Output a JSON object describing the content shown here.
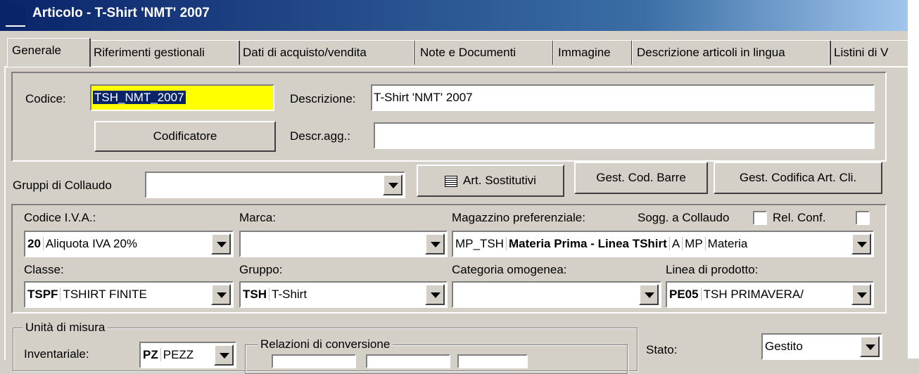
{
  "window": {
    "title": "Articolo - T-Shirt 'NMT' 2007"
  },
  "tabs": [
    "Generale",
    "Riferimenti gestionali",
    "Dati di acquisto/vendita",
    "Note e Documenti",
    "Immagine",
    "Descrizione articoli in lingua",
    "Listini di V"
  ],
  "header": {
    "codice_label": "Codice:",
    "codice_value": "TSH_NMT_2007",
    "descrizione_label": "Descrizione:",
    "descrizione_value": "T-Shirt 'NMT' 2007",
    "codificatore_label": "Codificatore",
    "descr_agg_label": "Descr.agg.:",
    "descr_agg_value": ""
  },
  "gruppi": {
    "label": "Gruppi di Collaudo",
    "value": "",
    "art_sostitutivi": "Art. Sostitutivi",
    "gest_cod_barre": "Gest. Cod. Barre",
    "gest_codifica": "Gest. Codifica Art. Cli."
  },
  "fields": {
    "iva_label": "Codice I.V.A.:",
    "iva_code": "20",
    "iva_desc": "Aliquota IVA 20%",
    "marca_label": "Marca:",
    "marca_value": "",
    "magazzino_label": "Magazzino preferenziale:",
    "magazzino_code": "MP_TSH",
    "magazzino_desc": "Materia Prima - Linea TShirt",
    "magazzino_extra1": "A",
    "magazzino_extra2": "MP",
    "magazzino_extra3": "Materia",
    "sogg_collaudo_label": "Sogg. a Collaudo",
    "rel_conf_label": "Rel. Conf.",
    "classe_label": "Classe:",
    "classe_code": "TSPF",
    "classe_desc": "TSHIRT FINITE",
    "gruppo_label": "Gruppo:",
    "gruppo_code": "TSH",
    "gruppo_desc": "T-Shirt",
    "categoria_label": "Categoria omogenea:",
    "categoria_value": "",
    "linea_label": "Linea di prodotto:",
    "linea_code": "PE05",
    "linea_desc": "TSH PRIMAVERA/"
  },
  "unita": {
    "group_title": "Unità di misura",
    "inventariale_label": "Inventariale:",
    "inventariale_code": "PZ",
    "inventariale_desc": "PEZZ",
    "relazioni_title": "Relazioni di conversione"
  },
  "stato": {
    "label": "Stato:",
    "value": "Gestito"
  },
  "colors": {
    "highlight_field": "#ffff00",
    "title_start": "#0a246a",
    "title_end": "#a6caf0"
  }
}
